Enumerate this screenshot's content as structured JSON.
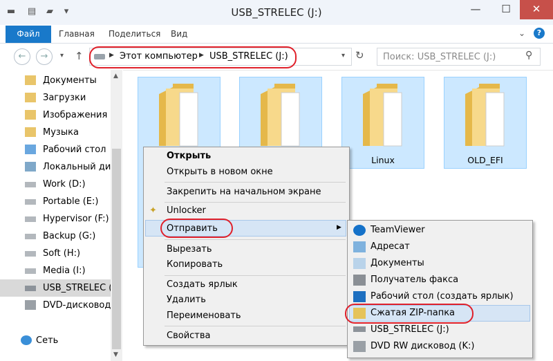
{
  "window": {
    "title": "USB_STRELEC (J:)"
  },
  "ribbon": {
    "tabs": [
      "Файл",
      "Главная",
      "Поделиться",
      "Вид"
    ]
  },
  "address": {
    "path": [
      "Этот компьютер",
      "USB_STRELEC (J:)"
    ]
  },
  "search": {
    "placeholder": "Поиск: USB_STRELEC (J:)"
  },
  "sidebar": {
    "items": [
      "Документы",
      "Загрузки",
      "Изображения",
      "Музыка",
      "Рабочий стол",
      "Локальный дис",
      "Work (D:)",
      "Portable (E:)",
      "Hypervisor (F:)",
      "Backup (G:)",
      "Soft (H:)",
      "Media (I:)",
      "USB_STRELEC (J:",
      "DVD-дисковод",
      "Сеть"
    ]
  },
  "folders": [
    "",
    "",
    "Linux",
    "OLD_EFI"
  ],
  "context_menu": {
    "items": [
      "Открыть",
      "Открыть в новом окне",
      "Закрепить на начальном экране",
      "Unlocker",
      "Отправить",
      "Вырезать",
      "Копировать",
      "Создать ярлык",
      "Удалить",
      "Переименовать",
      "Свойства"
    ]
  },
  "send_to": {
    "items": [
      "TeamViewer",
      "Адресат",
      "Документы",
      "Получатель факса",
      "Рабочий стол (создать ярлык)",
      "Сжатая ZIP-папка",
      "USB_STRELEC (J:)",
      "DVD RW дисковод (K:)"
    ]
  },
  "colors": {
    "accent": "#1979ca",
    "highlight_ring": "#e0202a",
    "selection": "#cce8ff"
  }
}
